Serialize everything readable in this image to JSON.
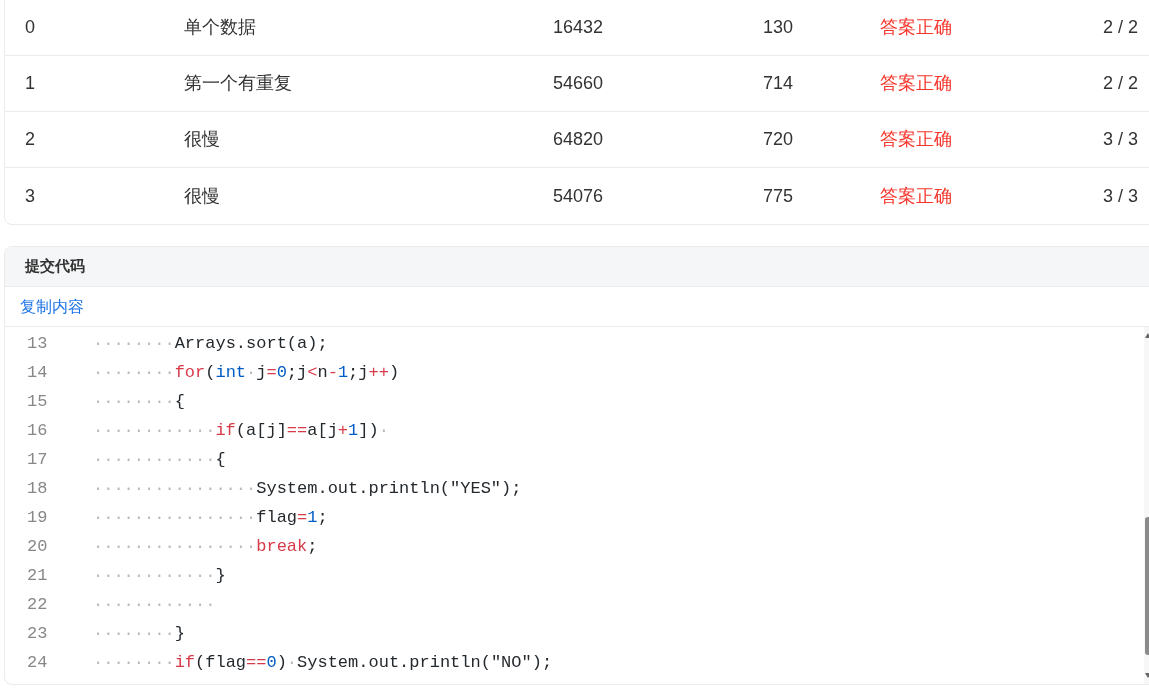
{
  "results_table": {
    "rows": [
      {
        "column_1": "0",
        "column_2": "单个数据",
        "column_3": "16432",
        "column_4": "130",
        "column_5": "答案正确",
        "column_6": "2 / 2"
      },
      {
        "column_1": "1",
        "column_2": "第一个有重复",
        "column_3": "54660",
        "column_4": "714",
        "column_5": "答案正确",
        "column_6": "2 / 2"
      },
      {
        "column_1": "2",
        "column_2": "很慢",
        "column_3": "64820",
        "column_4": "720",
        "column_5": "答案正确",
        "column_6": "3 / 3"
      },
      {
        "column_1": "3",
        "column_2": "很慢",
        "column_3": "54076",
        "column_4": "775",
        "column_5": "答案正确",
        "column_6": "3 / 3"
      }
    ]
  },
  "code_panel": {
    "title": "提交代码",
    "copy_link": "复制内容",
    "lines": [
      {
        "number": "13",
        "tokens": [
          {
            "kind": "whitespace",
            "text": "········"
          },
          {
            "kind": "plain",
            "text": "Arrays.sort(a);"
          }
        ]
      },
      {
        "number": "14",
        "tokens": [
          {
            "kind": "whitespace",
            "text": "········"
          },
          {
            "kind": "keyword",
            "text": "for"
          },
          {
            "kind": "plain",
            "text": "("
          },
          {
            "kind": "type",
            "text": "int"
          },
          {
            "kind": "whitespace",
            "text": "·"
          },
          {
            "kind": "plain",
            "text": "j"
          },
          {
            "kind": "operator",
            "text": "="
          },
          {
            "kind": "number",
            "text": "0"
          },
          {
            "kind": "plain",
            "text": ";j"
          },
          {
            "kind": "operator",
            "text": "<"
          },
          {
            "kind": "plain",
            "text": "n"
          },
          {
            "kind": "operator",
            "text": "-"
          },
          {
            "kind": "number",
            "text": "1"
          },
          {
            "kind": "plain",
            "text": ";j"
          },
          {
            "kind": "operator",
            "text": "++"
          },
          {
            "kind": "plain",
            "text": ")"
          }
        ]
      },
      {
        "number": "15",
        "tokens": [
          {
            "kind": "whitespace",
            "text": "········"
          },
          {
            "kind": "plain",
            "text": "{"
          }
        ]
      },
      {
        "number": "16",
        "tokens": [
          {
            "kind": "whitespace",
            "text": "············"
          },
          {
            "kind": "keyword",
            "text": "if"
          },
          {
            "kind": "plain",
            "text": "(a[j]"
          },
          {
            "kind": "operator",
            "text": "=="
          },
          {
            "kind": "plain",
            "text": "a[j"
          },
          {
            "kind": "operator",
            "text": "+"
          },
          {
            "kind": "number",
            "text": "1"
          },
          {
            "kind": "plain",
            "text": "])"
          },
          {
            "kind": "whitespace",
            "text": "·"
          }
        ]
      },
      {
        "number": "17",
        "tokens": [
          {
            "kind": "whitespace",
            "text": "············"
          },
          {
            "kind": "plain",
            "text": "{"
          }
        ]
      },
      {
        "number": "18",
        "tokens": [
          {
            "kind": "whitespace",
            "text": "················"
          },
          {
            "kind": "plain",
            "text": "System.out.println(\"YES\");"
          }
        ]
      },
      {
        "number": "19",
        "tokens": [
          {
            "kind": "whitespace",
            "text": "················"
          },
          {
            "kind": "plain",
            "text": "flag"
          },
          {
            "kind": "operator",
            "text": "="
          },
          {
            "kind": "number",
            "text": "1"
          },
          {
            "kind": "plain",
            "text": ";"
          }
        ]
      },
      {
        "number": "20",
        "tokens": [
          {
            "kind": "whitespace",
            "text": "················"
          },
          {
            "kind": "keyword",
            "text": "break"
          },
          {
            "kind": "plain",
            "text": ";"
          }
        ]
      },
      {
        "number": "21",
        "tokens": [
          {
            "kind": "whitespace",
            "text": "············"
          },
          {
            "kind": "plain",
            "text": "}"
          }
        ]
      },
      {
        "number": "22",
        "tokens": [
          {
            "kind": "whitespace",
            "text": "············"
          }
        ]
      },
      {
        "number": "23",
        "tokens": [
          {
            "kind": "whitespace",
            "text": "········"
          },
          {
            "kind": "plain",
            "text": "}"
          }
        ]
      },
      {
        "number": "24",
        "tokens": [
          {
            "kind": "whitespace",
            "text": "········"
          },
          {
            "kind": "keyword",
            "text": "if"
          },
          {
            "kind": "plain",
            "text": "(flag"
          },
          {
            "kind": "operator",
            "text": "=="
          },
          {
            "kind": "number",
            "text": "0"
          },
          {
            "kind": "plain",
            "text": ")"
          },
          {
            "kind": "whitespace",
            "text": "·"
          },
          {
            "kind": "plain",
            "text": "System.out.println(\"NO\");"
          }
        ]
      }
    ]
  }
}
